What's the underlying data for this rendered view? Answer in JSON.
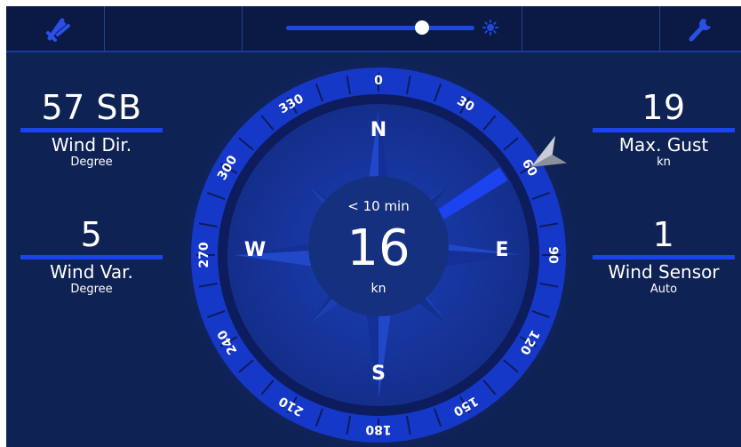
{
  "topbar": {
    "left_icon": "wind-vane-icon",
    "right_icon": "wrench-icon",
    "brightness_level": 0.72,
    "brightness_low_icon": "moon-icon",
    "brightness_high_icon": "sun-icon"
  },
  "panels": {
    "wind_dir": {
      "value": "57 SB",
      "label": "Wind Dir.",
      "unit": "Degree"
    },
    "wind_var": {
      "value": "5",
      "label": "Wind Var.",
      "unit": "Degree"
    },
    "max_gust": {
      "value": "19",
      "label": "Max. Gust",
      "unit": "kn"
    },
    "wind_sensor": {
      "value": "1",
      "label": "Wind Sensor",
      "unit": "Auto"
    }
  },
  "compass": {
    "period": "< 10 min",
    "speed": "16",
    "speed_unit": "kn",
    "cardinals": {
      "n": "N",
      "e": "E",
      "s": "S",
      "w": "W"
    },
    "degree_labels": [
      "0",
      "30",
      "60",
      "90",
      "120",
      "150",
      "180",
      "210",
      "240",
      "270",
      "300",
      "330"
    ],
    "wind_direction_deg": 57,
    "gust_direction_deg": 60
  },
  "colors": {
    "background": "#0f2254",
    "accent": "#1a44ee",
    "text": "#ffffff"
  }
}
